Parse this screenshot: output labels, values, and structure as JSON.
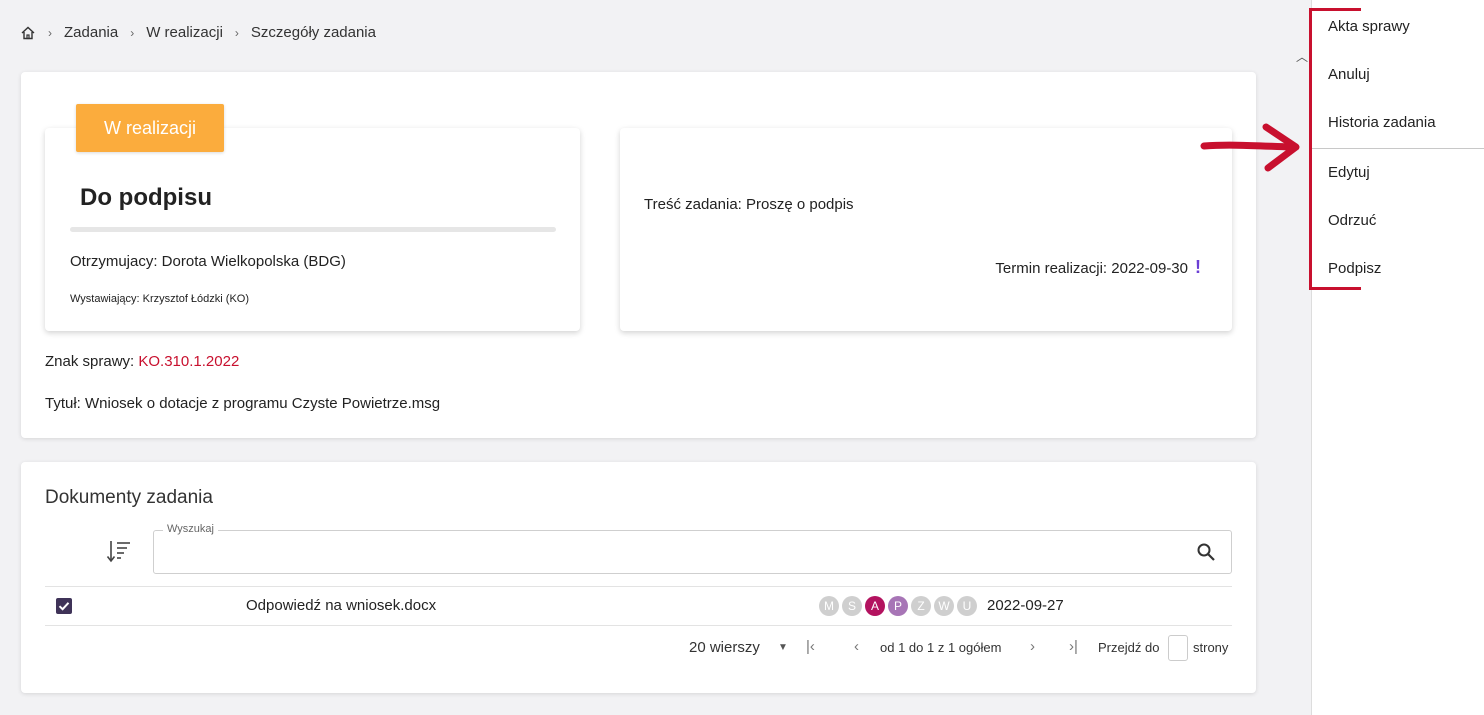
{
  "breadcrumb": {
    "items": [
      "Zadania",
      "W realizacji",
      "Szczegóły zadania"
    ]
  },
  "task": {
    "status": "W realizacji",
    "title": "Do podpisu",
    "recipient": "Otrzymujacy: Dorota Wielkopolska (BDG)",
    "issuer": "Wystawiający: Krzysztof Łódzki (KO)",
    "content": "Treść zadania: Proszę o podpis",
    "deadline": "Termin realizacji: 2022-09-30",
    "deadline_flag": "!",
    "case_sign_label": "Znak sprawy: ",
    "case_sign_value": "KO.310.1.2022",
    "case_title": "Tytuł: Wniosek o dotacje z programu Czyste Powietrze.msg"
  },
  "documents": {
    "title": "Dokumenty zadania",
    "search_label": "Wyszukaj",
    "rows": [
      {
        "name": "Odpowiedź na wniosek.docx",
        "flags": [
          "M",
          "S",
          "A",
          "P",
          "Z",
          "W",
          "U"
        ],
        "date": "2022-09-27"
      }
    ]
  },
  "pagination": {
    "rows_per_page": "20 wierszy",
    "range": "od 1 do 1 z 1 ogółem",
    "goto_label": "Przejdź do",
    "pages_label": "strony"
  },
  "actions": {
    "items": [
      "Akta sprawy",
      "Anuluj",
      "Historia zadania",
      "Edytuj",
      "Odrzuć",
      "Podpisz"
    ]
  },
  "colors": {
    "status": "#fbac3d",
    "accent_red": "#c8102e",
    "flag_active": "#b3125f",
    "flag_pending": "#a775b6"
  }
}
